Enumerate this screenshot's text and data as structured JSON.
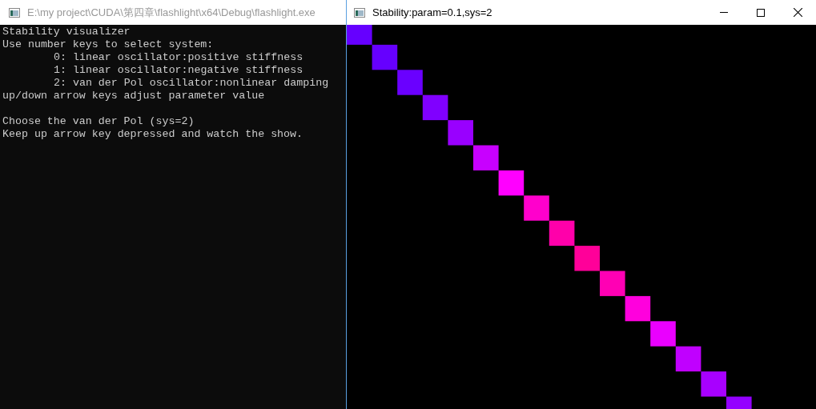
{
  "console_window": {
    "title": "E:\\my project\\CUDA\\第四章\\flashlight\\x64\\Debug\\flashlight.exe",
    "active": false,
    "lines": [
      {
        "kind": "plain",
        "text": "Stability visualizer"
      },
      {
        "kind": "plain",
        "text": "Use number keys to select system:"
      },
      {
        "kind": "indented",
        "text": "0: linear oscillator:positive stiffness"
      },
      {
        "kind": "indented",
        "text": "1: linear oscillator:negative stiffness"
      },
      {
        "kind": "indented",
        "text": "2: van der Pol oscillator:nonlinear damping"
      },
      {
        "kind": "plain",
        "text": "up/down arrow keys adjust parameter value"
      },
      {
        "kind": "blank"
      },
      {
        "kind": "plain",
        "text": "Choose the van der Pol (sys=2)"
      },
      {
        "kind": "plain",
        "text": "Keep up arrow key depressed and watch the show."
      }
    ]
  },
  "graphics_window": {
    "title": "Stability:param=0.1,sys=2",
    "active": true
  }
}
